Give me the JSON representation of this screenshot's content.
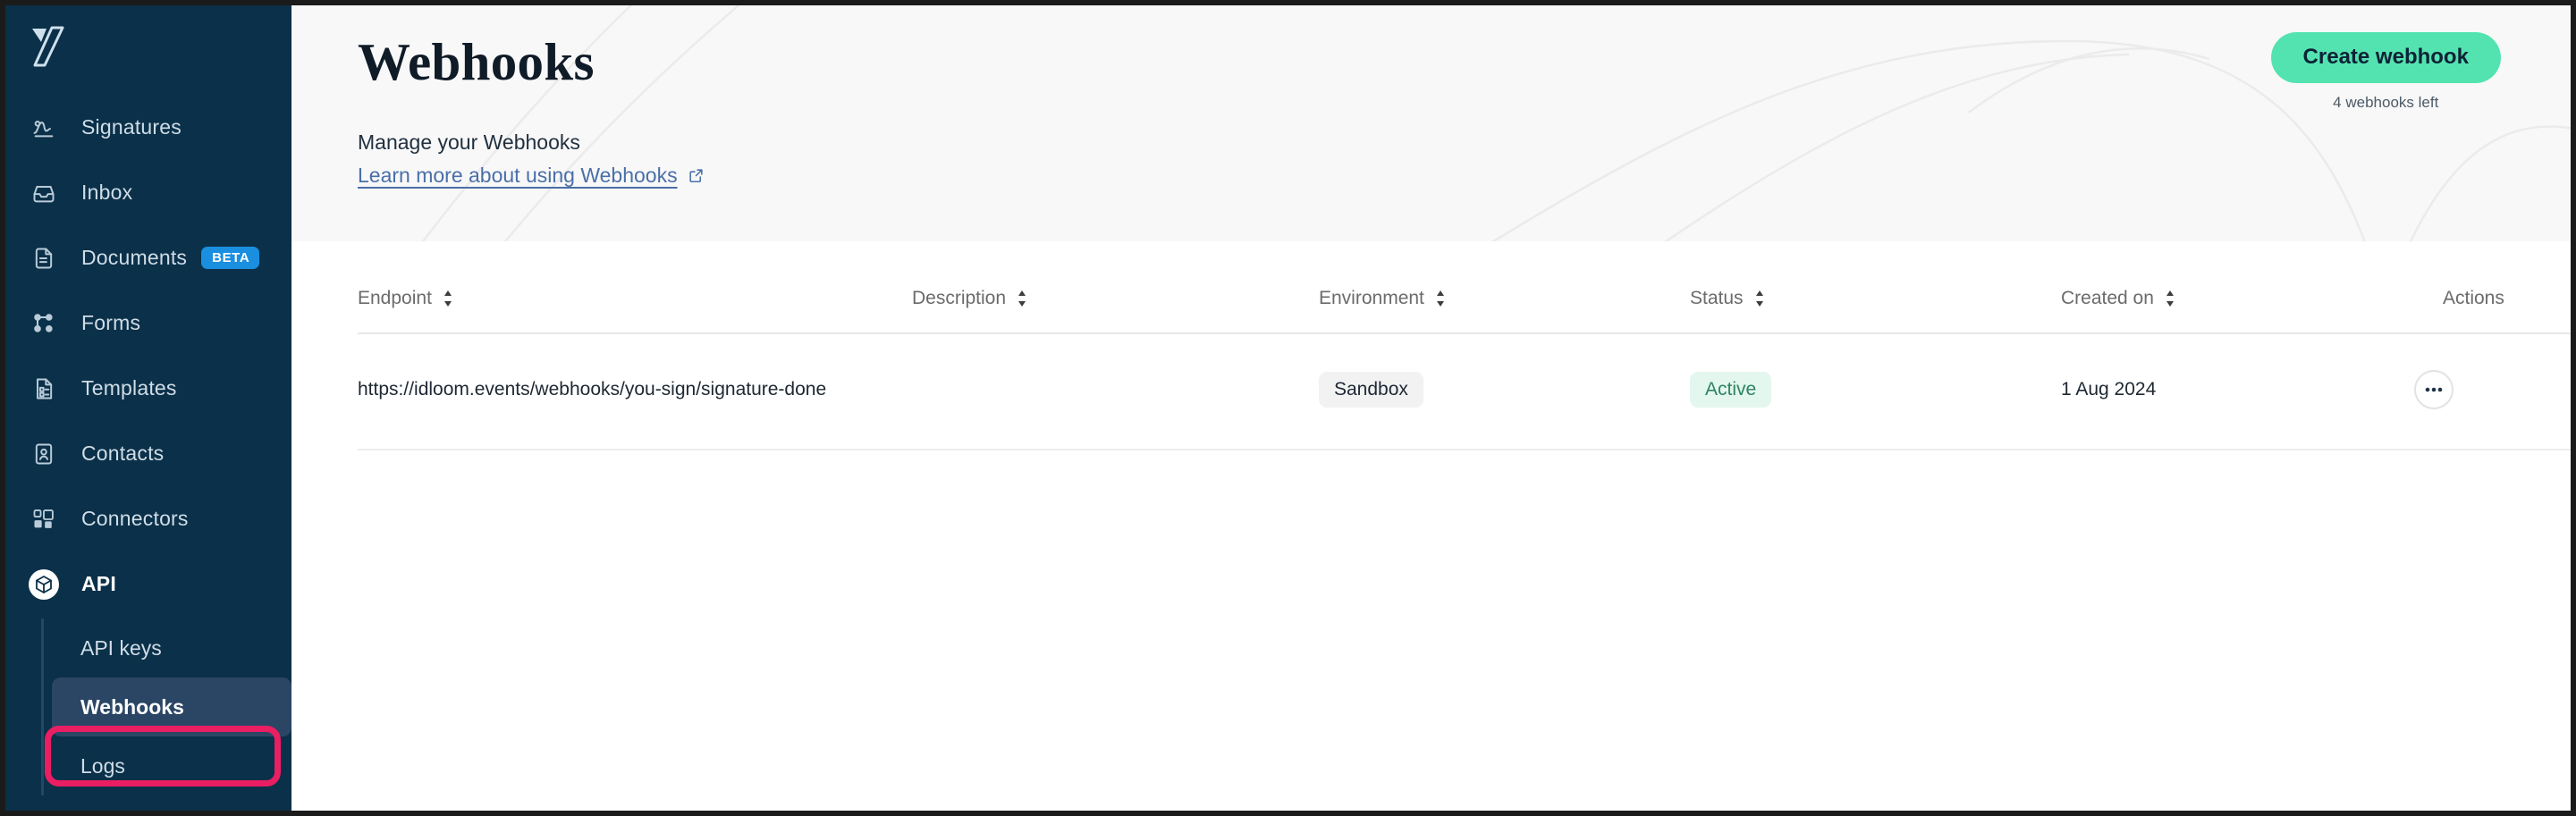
{
  "sidebar": {
    "logo_name": "yousign-logo",
    "items": [
      {
        "label": "Signatures",
        "icon": "signature-icon",
        "badge": null
      },
      {
        "label": "Inbox",
        "icon": "inbox-icon",
        "badge": null
      },
      {
        "label": "Documents",
        "icon": "document-icon",
        "badge": "BETA"
      },
      {
        "label": "Forms",
        "icon": "forms-icon",
        "badge": null
      },
      {
        "label": "Templates",
        "icon": "templates-icon",
        "badge": null
      },
      {
        "label": "Contacts",
        "icon": "contacts-icon",
        "badge": null
      },
      {
        "label": "Connectors",
        "icon": "connectors-icon",
        "badge": null
      },
      {
        "label": "API",
        "icon": "api-cube-icon",
        "badge": null
      }
    ],
    "subitems": [
      {
        "label": "API keys",
        "selected": false
      },
      {
        "label": "Webhooks",
        "selected": true
      },
      {
        "label": "Logs",
        "selected": false
      }
    ],
    "colors": {
      "background": "#0b3049",
      "selected_item": "#2b4664",
      "beta_badge": "#1a8fe0",
      "annotation": "#ea1e63"
    }
  },
  "hero": {
    "title": "Webhooks",
    "subtitle": "Manage your Webhooks",
    "link_label": "Learn more about using Webhooks",
    "link_icon": "external-link-icon",
    "cta_label": "Create webhook",
    "cta_note": "4 webhooks left",
    "cta_color": "#53e3b0",
    "link_color": "#4a6fa8"
  },
  "table": {
    "columns": [
      {
        "label": "Endpoint",
        "sortable": true
      },
      {
        "label": "Description",
        "sortable": true
      },
      {
        "label": "Environment",
        "sortable": true
      },
      {
        "label": "Status",
        "sortable": true
      },
      {
        "label": "Created on",
        "sortable": true
      },
      {
        "label": "Actions",
        "sortable": false
      }
    ],
    "rows": [
      {
        "endpoint": "https://idloom.events/webhooks/you-sign/signature-done",
        "description": "",
        "environment": "Sandbox",
        "status": "Active",
        "created_on": "1 Aug 2024",
        "action_icon": "ellipsis-icon"
      }
    ],
    "status_colors": {
      "active_bg": "#e3f7ee",
      "active_text": "#2f8363"
    }
  }
}
